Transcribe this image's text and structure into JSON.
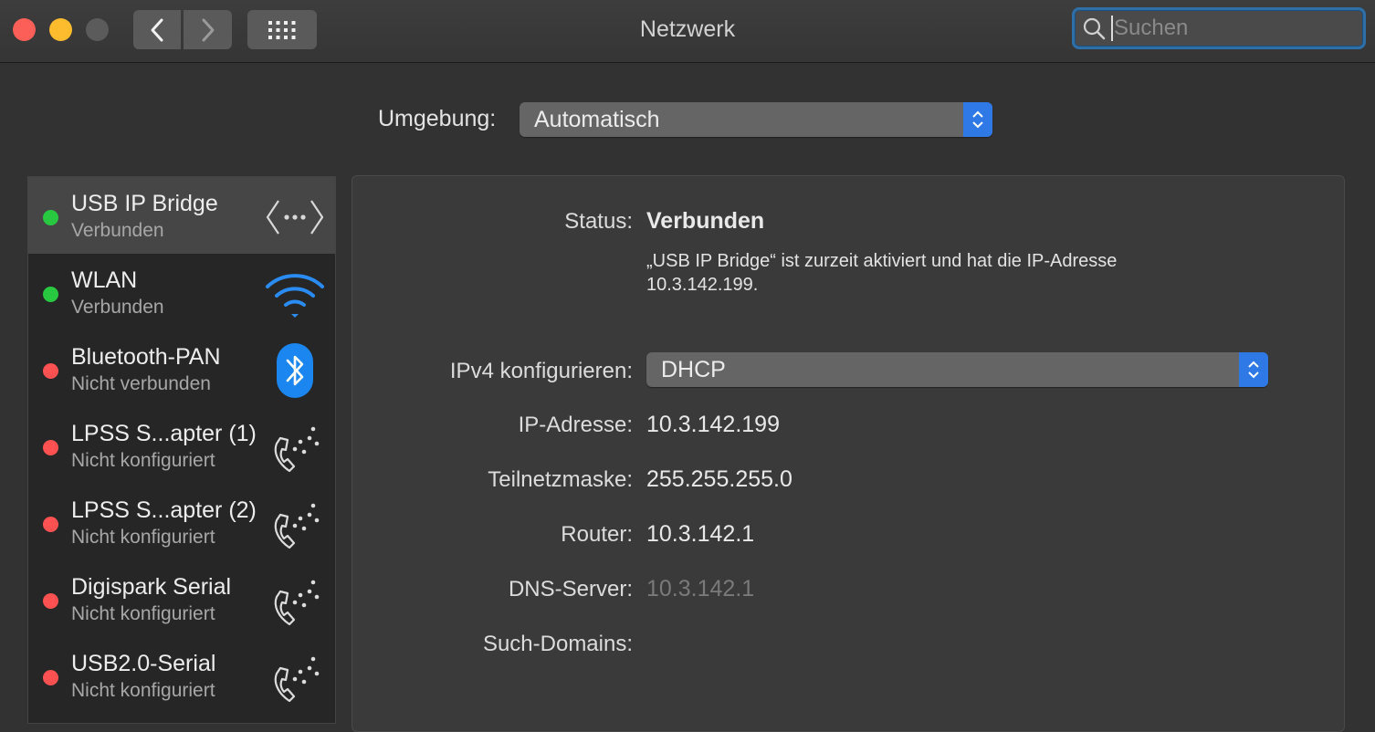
{
  "window": {
    "title": "Netzwerk"
  },
  "toolbar": {
    "search_placeholder": "Suchen"
  },
  "location": {
    "label": "Umgebung:",
    "value": "Automatisch"
  },
  "services": [
    {
      "name": "USB IP Bridge",
      "status": "Verbunden",
      "state_color": "#28c840",
      "icon": "ethernet-bridge-icon",
      "selected": true
    },
    {
      "name": "WLAN",
      "status": "Verbunden",
      "state_color": "#28c840",
      "icon": "wifi-icon"
    },
    {
      "name": "Bluetooth-PAN",
      "status": "Nicht verbunden",
      "state_color": "#ff5151",
      "icon": "bluetooth-icon"
    },
    {
      "name": "LPSS S...apter (1)",
      "status": "Nicht konfiguriert",
      "state_color": "#ff5151",
      "icon": "modem-phone-icon"
    },
    {
      "name": "LPSS S...apter (2)",
      "status": "Nicht konfiguriert",
      "state_color": "#ff5151",
      "icon": "modem-phone-icon"
    },
    {
      "name": "Digispark Serial",
      "status": "Nicht konfiguriert",
      "state_color": "#ff5151",
      "icon": "modem-phone-icon"
    },
    {
      "name": "USB2.0-Serial",
      "status": "Nicht konfiguriert",
      "state_color": "#ff5151",
      "icon": "modem-phone-icon"
    }
  ],
  "detail": {
    "status_label": "Status:",
    "status_value": "Verbunden",
    "description": "„USB IP Bridge“ ist zurzeit aktiviert und hat die IP-Adresse 10.3.142.199.",
    "ipv4_label": "IPv4 konfigurieren:",
    "ipv4_value": "DHCP",
    "ip_label": "IP-Adresse:",
    "ip_value": "10.3.142.199",
    "mask_label": "Teilnetzmaske:",
    "mask_value": "255.255.255.0",
    "router_label": "Router:",
    "router_value": "10.3.142.1",
    "dns_label": "DNS-Server:",
    "dns_value": "10.3.142.1",
    "domains_label": "Such-Domains:"
  }
}
